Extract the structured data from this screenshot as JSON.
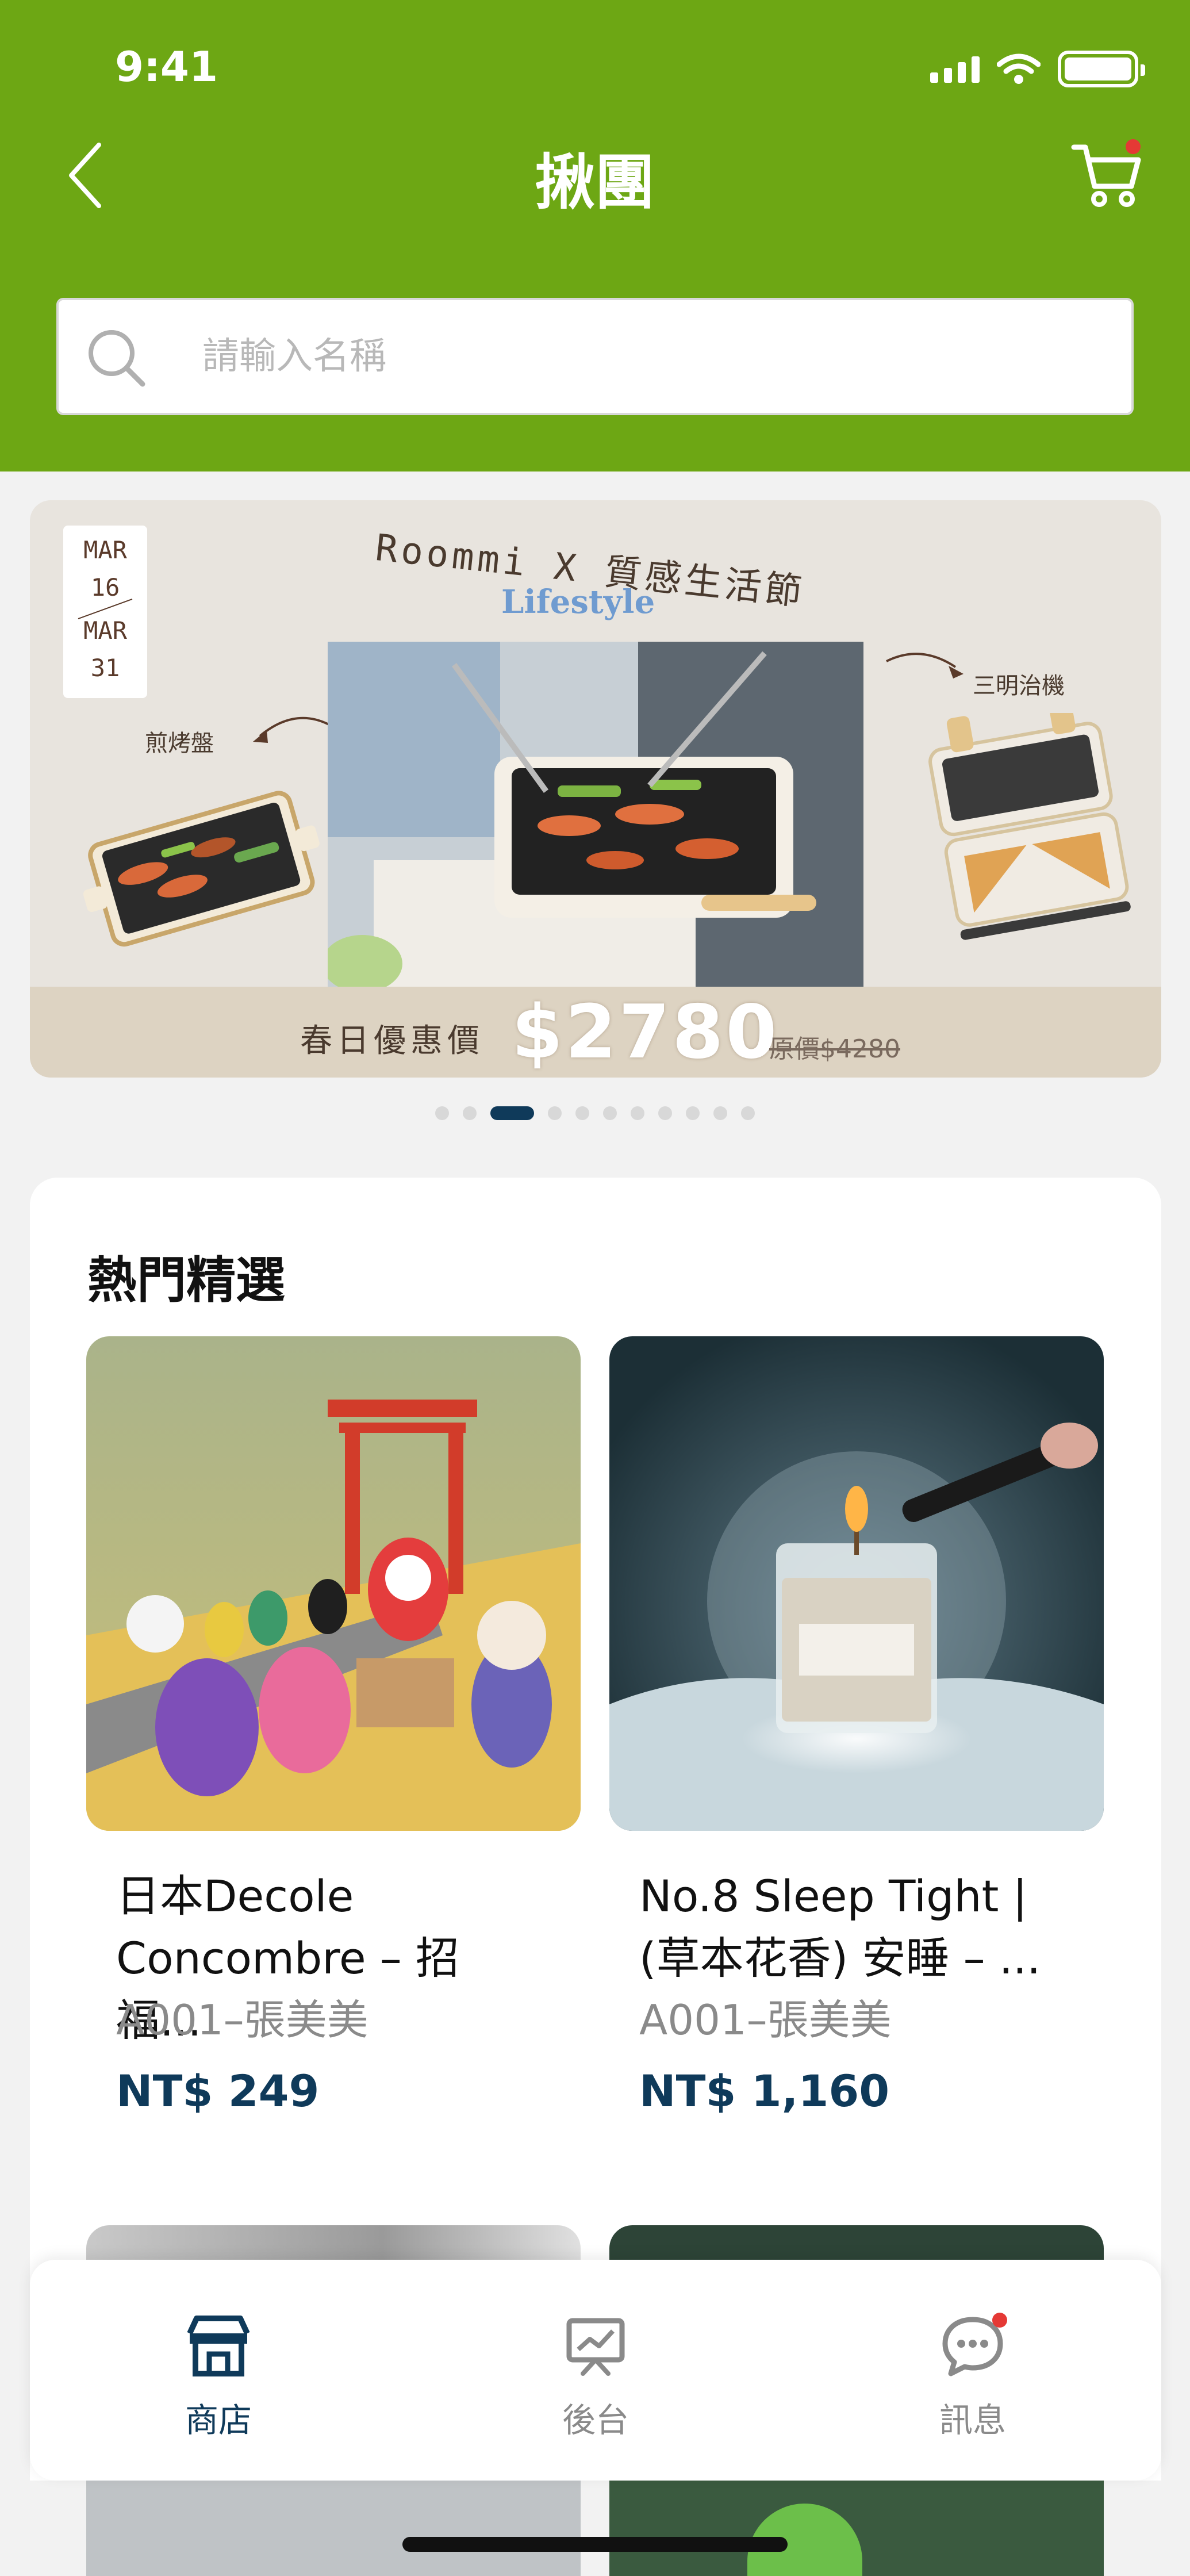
{
  "status_bar": {
    "time": "9:41"
  },
  "nav": {
    "title": "揪團"
  },
  "search": {
    "placeholder": "請輸入名稱"
  },
  "banner": {
    "date_start_month": "MAR",
    "date_start_day": "16",
    "date_end_month": "MAR",
    "date_end_day": "31",
    "title": "Roommi X 質感生活節",
    "subtitle": "Lifestyle",
    "label_left": "煎烤盤",
    "label_right": "三明治機",
    "price_label": "春日優惠價",
    "price": "$2780",
    "original_price": "原價$4280"
  },
  "carousel": {
    "total": 11,
    "active_index": 2
  },
  "hot": {
    "title": "熱門精選",
    "products": [
      {
        "name": "日本Decole Concombre – 招福...",
        "seller": "A001–張美美",
        "price": "NT$ 249"
      },
      {
        "name": "No.8 Sleep Tight | (草本花香) 安睡 – ...",
        "seller": "A001–張美美",
        "price": "NT$ 1,160"
      }
    ]
  },
  "tabbar": {
    "items": [
      {
        "label": "商店",
        "active": true
      },
      {
        "label": "後台",
        "active": false
      },
      {
        "label": "訊息",
        "active": false
      }
    ]
  },
  "colors": {
    "brand_green": "#6DA714",
    "primary_navy": "#0F3A5A",
    "badge_red": "#E53935",
    "inactive_gray": "#8A8A8A"
  }
}
